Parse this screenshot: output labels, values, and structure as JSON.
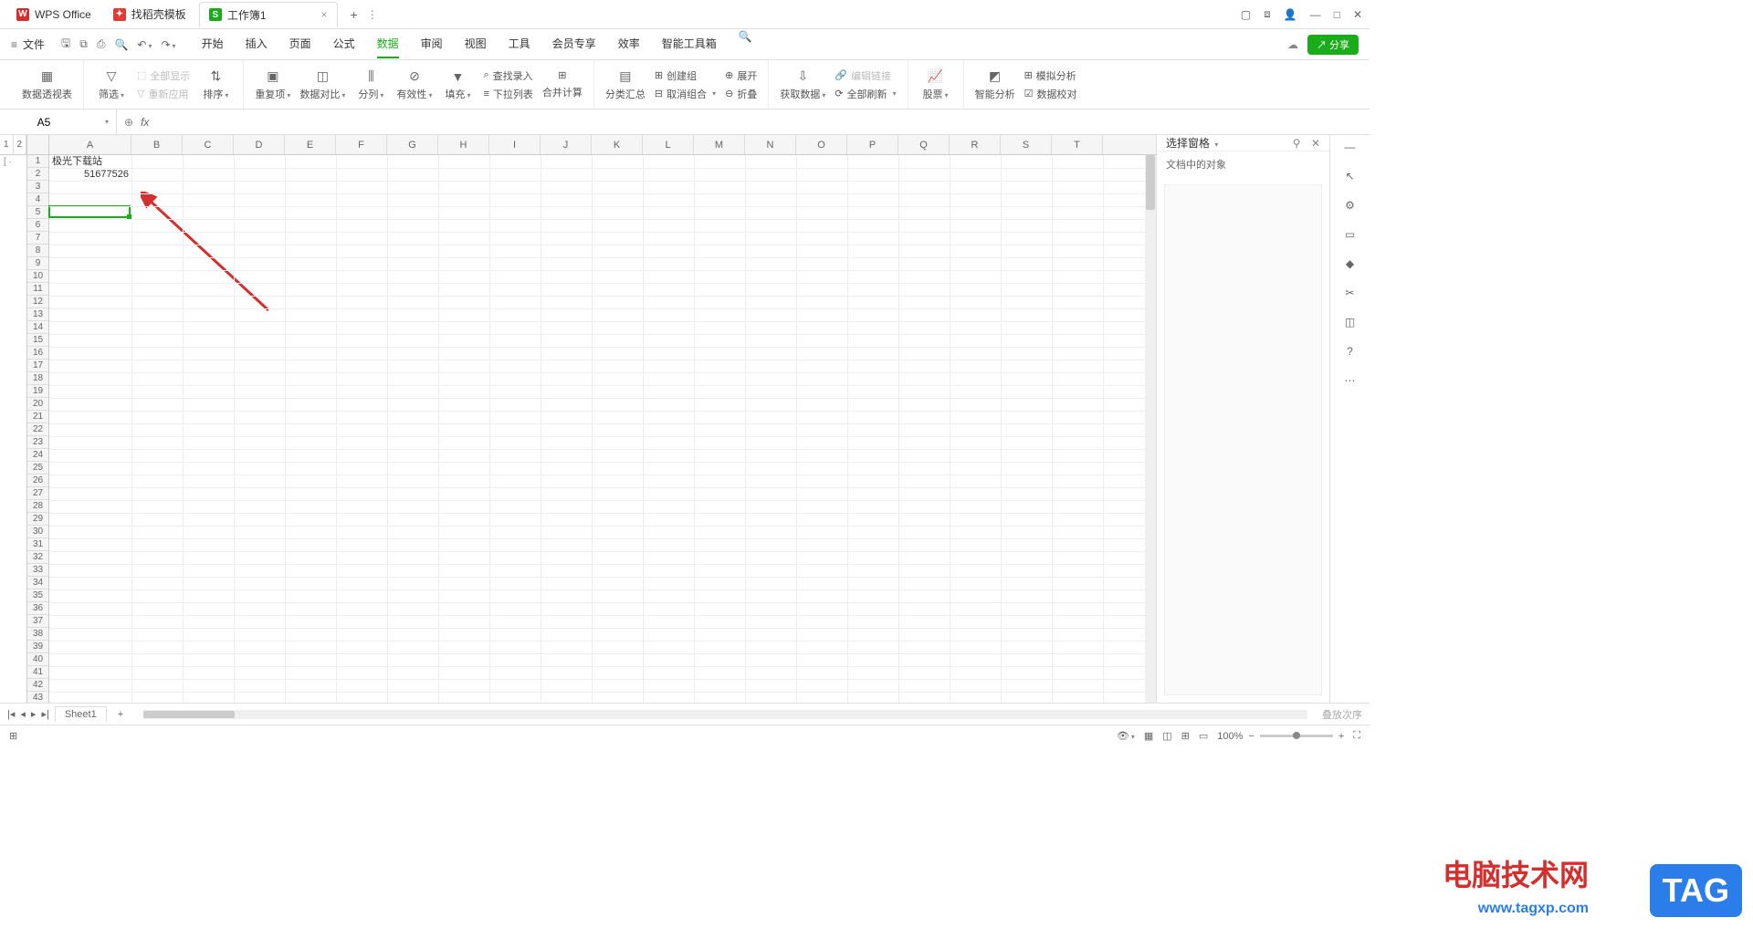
{
  "titlebar": {
    "tabs": [
      {
        "icon": "W",
        "label": "WPS Office"
      },
      {
        "icon": "✦",
        "label": "找稻壳模板"
      },
      {
        "icon": "S",
        "label": "工作簿1"
      }
    ],
    "close": "×",
    "add": "+"
  },
  "menubar": {
    "file": "文件",
    "tabs": [
      "开始",
      "插入",
      "页面",
      "公式",
      "数据",
      "审阅",
      "视图",
      "工具",
      "会员专享",
      "效率",
      "智能工具箱"
    ],
    "active": "数据",
    "share": "分享"
  },
  "ribbon": {
    "pivot": "数据透视表",
    "filter": "筛选",
    "show_all": "全部显示",
    "reapply": "重新应用",
    "sort": "排序",
    "dedup": "重复项",
    "compare": "数据对比",
    "split": "分列",
    "validity": "有效性",
    "fill": "填充",
    "find_entry": "查找录入",
    "merge_calc": "合并计算",
    "dropdown": "下拉列表",
    "subtotal": "分类汇总",
    "group": "创建组",
    "ungroup": "取消组合",
    "expand": "展开",
    "collapse": "折叠",
    "get_data": "获取数据",
    "edit_link": "编辑链接",
    "refresh_all": "全部刷新",
    "stock": "股票",
    "smart_analysis": "智能分析",
    "simulate": "模拟分析",
    "data_check": "数据校对"
  },
  "formula": {
    "cell_ref": "A5",
    "fx": "fx"
  },
  "grid": {
    "columns": [
      "A",
      "B",
      "C",
      "D",
      "E",
      "F",
      "G",
      "H",
      "I",
      "J",
      "K",
      "L",
      "M",
      "N",
      "O",
      "P",
      "Q",
      "R",
      "S",
      "T"
    ],
    "rows": 43,
    "outline": [
      "1",
      "2"
    ],
    "data": {
      "A1": "极光下载站",
      "A2": "51677526"
    },
    "selected": {
      "col": 0,
      "row": 4
    }
  },
  "right_panel": {
    "title": "选择窗格",
    "subtitle": "文档中的对象"
  },
  "sheets": {
    "tab": "Sheet1",
    "add": "+",
    "order": "叠放次序"
  },
  "status": {
    "zoom": "100%",
    "minus": "−",
    "plus": "+"
  },
  "watermark": {
    "title": "电脑技术网",
    "url": "www.tagxp.com",
    "tag": "TAG"
  }
}
